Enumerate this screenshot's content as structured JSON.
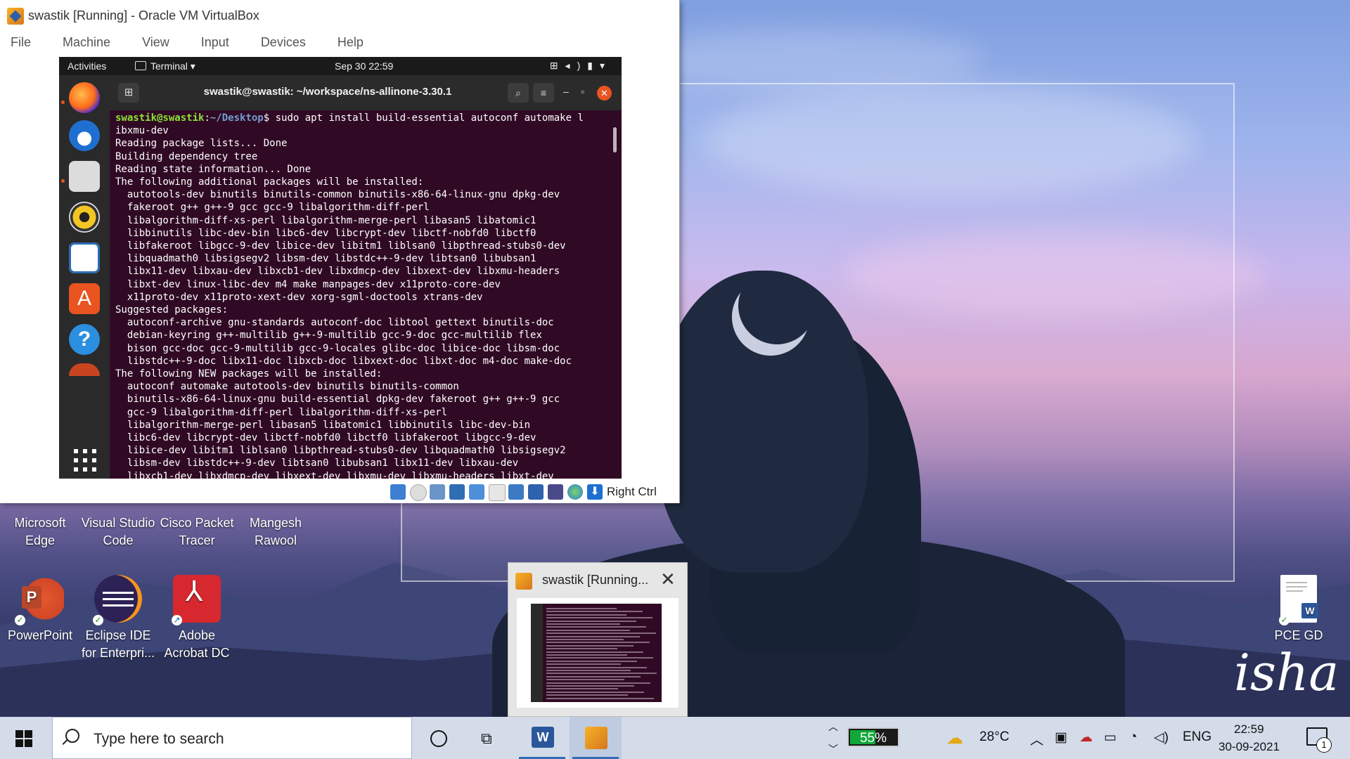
{
  "vbox": {
    "title": "swastik [Running] - Oracle VM VirtualBox",
    "menu": [
      "File",
      "Machine",
      "View",
      "Input",
      "Devices",
      "Help"
    ],
    "status_host_key": "Right Ctrl"
  },
  "gnome": {
    "activities": "Activities",
    "app_menu": "Terminal ▾",
    "clock": "Sep 30  22:59",
    "tray_icons": [
      "network-icon",
      "volume-icon",
      "battery-icon",
      "power-menu-icon"
    ]
  },
  "terminal": {
    "title": "swastik@swastik: ~/workspace/ns-allinone-3.30.1",
    "prompt_user": "swastik@swastik",
    "prompt_path": "~/Desktop",
    "command": "$ sudo apt install build-essential autoconf automake l",
    "output": [
      "ibxmu-dev",
      "Reading package lists... Done",
      "Building dependency tree",
      "Reading state information... Done",
      "The following additional packages will be installed:",
      "  autotools-dev binutils binutils-common binutils-x86-64-linux-gnu dpkg-dev",
      "  fakeroot g++ g++-9 gcc gcc-9 libalgorithm-diff-perl",
      "  libalgorithm-diff-xs-perl libalgorithm-merge-perl libasan5 libatomic1",
      "  libbinutils libc-dev-bin libc6-dev libcrypt-dev libctf-nobfd0 libctf0",
      "  libfakeroot libgcc-9-dev libice-dev libitm1 liblsan0 libpthread-stubs0-dev",
      "  libquadmath0 libsigsegv2 libsm-dev libstdc++-9-dev libtsan0 libubsan1",
      "  libx11-dev libxau-dev libxcb1-dev libxdmcp-dev libxext-dev libxmu-headers",
      "  libxt-dev linux-libc-dev m4 make manpages-dev x11proto-core-dev",
      "  x11proto-dev x11proto-xext-dev xorg-sgml-doctools xtrans-dev",
      "Suggested packages:",
      "  autoconf-archive gnu-standards autoconf-doc libtool gettext binutils-doc",
      "  debian-keyring g++-multilib g++-9-multilib gcc-9-doc gcc-multilib flex",
      "  bison gcc-doc gcc-9-multilib gcc-9-locales glibc-doc libice-doc libsm-doc",
      "  libstdc++-9-doc libx11-doc libxcb-doc libxext-doc libxt-doc m4-doc make-doc",
      "The following NEW packages will be installed:",
      "  autoconf automake autotools-dev binutils binutils-common",
      "  binutils-x86-64-linux-gnu build-essential dpkg-dev fakeroot g++ g++-9 gcc",
      "  gcc-9 libalgorithm-diff-perl libalgorithm-diff-xs-perl",
      "  libalgorithm-merge-perl libasan5 libatomic1 libbinutils libc-dev-bin",
      "  libc6-dev libcrypt-dev libctf-nobfd0 libctf0 libfakeroot libgcc-9-dev",
      "  libice-dev libitm1 liblsan0 libpthread-stubs0-dev libquadmath0 libsigsegv2",
      "  libsm-dev libstdc++-9-dev libtsan0 libubsan1 libx11-dev libxau-dev",
      "  libxcb1-dev libxdmcp-dev libxext-dev libxmu-dev libxmu-headers libxt-dev"
    ]
  },
  "desktop_icons": {
    "edge": "Microsoft Edge",
    "vscode": "Visual Studio Code",
    "cisco": "Cisco Packet Tracer",
    "mangesh": "Mangesh Rawool",
    "powerpoint": "PowerPoint",
    "eclipse": "Eclipse IDE for Enterpri...",
    "acrobat": "Adobe Acrobat DC",
    "pcegd": "PCE GD"
  },
  "wallpaper_watermark": "isha",
  "thumbnail": {
    "title": "swastik [Running..."
  },
  "taskbar": {
    "search_placeholder": "Type here to search",
    "battery_percent": "55%",
    "battery_level": 0.55,
    "weather": "28°C",
    "language": "ENG",
    "time": "22:59",
    "date": "30-09-2021",
    "notification_count": "1"
  },
  "colors": {
    "terminal_bg": "#300a24",
    "prompt_user": "#8ae234",
    "prompt_path": "#729fcf",
    "ubuntu_accent": "#e95420",
    "taskbar_bg": "#d4dcea"
  }
}
